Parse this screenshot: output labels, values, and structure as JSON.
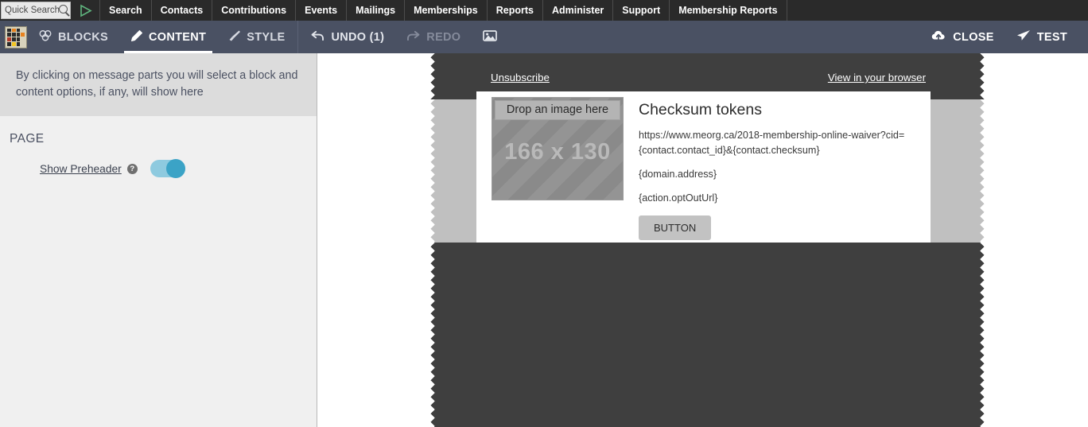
{
  "civi_nav": {
    "quick_search": {
      "placeholder": "Quick Search",
      "value": "",
      "icon": "magnifier-icon"
    },
    "home_icon": "play-triangle-icon",
    "items": [
      {
        "label": "Search"
      },
      {
        "label": "Contacts"
      },
      {
        "label": "Contributions"
      },
      {
        "label": "Events"
      },
      {
        "label": "Mailings"
      },
      {
        "label": "Memberships"
      },
      {
        "label": "Reports"
      },
      {
        "label": "Administer"
      },
      {
        "label": "Support"
      },
      {
        "label": "Membership Reports"
      }
    ]
  },
  "toolbar": {
    "brand_icon": "mosaico-logo-icon",
    "tabs": [
      {
        "label": "BLOCKS",
        "icon": "blocks-icon",
        "active": false
      },
      {
        "label": "CONTENT",
        "icon": "pencil-icon",
        "active": true
      },
      {
        "label": "STYLE",
        "icon": "paintbrush-icon",
        "active": false
      }
    ],
    "undo_label": "UNDO (1)",
    "undo_icon": "undo-arrow-icon",
    "redo_label": "REDO",
    "redo_icon": "redo-arrow-icon",
    "gallery_icon": "image-gallery-icon",
    "close_label": "CLOSE",
    "close_icon": "cloud-upload-icon",
    "test_label": "TEST",
    "test_icon": "paper-plane-icon"
  },
  "left_panel": {
    "hint": "By clicking on message parts you will select a block and content options, if any, will show here",
    "section_title": "PAGE",
    "preheader": {
      "label": "Show Preheader",
      "help_glyph": "?",
      "toggle_state": "on"
    }
  },
  "preview": {
    "preheader": {
      "unsubscribe_label": "Unsubscribe",
      "view_browser_label": "View in your browser"
    },
    "content_block": {
      "image_placeholder": {
        "drop_label": "Drop an image here",
        "dimensions": "166 x 130"
      },
      "heading": "Checksum tokens",
      "paragraphs": [
        "https://www.meorg.ca/2018-membership-online-waiver?cid={contact.contact_id}&{contact.checksum}",
        "{domain.address}",
        "{action.optOutUrl}"
      ],
      "button_label": "BUTTON"
    }
  },
  "colors": {
    "civi_nav_bg": "#2a2a2a",
    "toolbar_bg": "#4a5163",
    "panel_bg": "#f0f0f0",
    "panel_hint_bg": "#dcdcdc",
    "toggle_on_track": "#8ecadf",
    "toggle_on_knob": "#3ba3c6",
    "email_dark": "#3f3f3f",
    "email_gray": "#c0c0c0",
    "button_bg": "#c2c2c2"
  }
}
